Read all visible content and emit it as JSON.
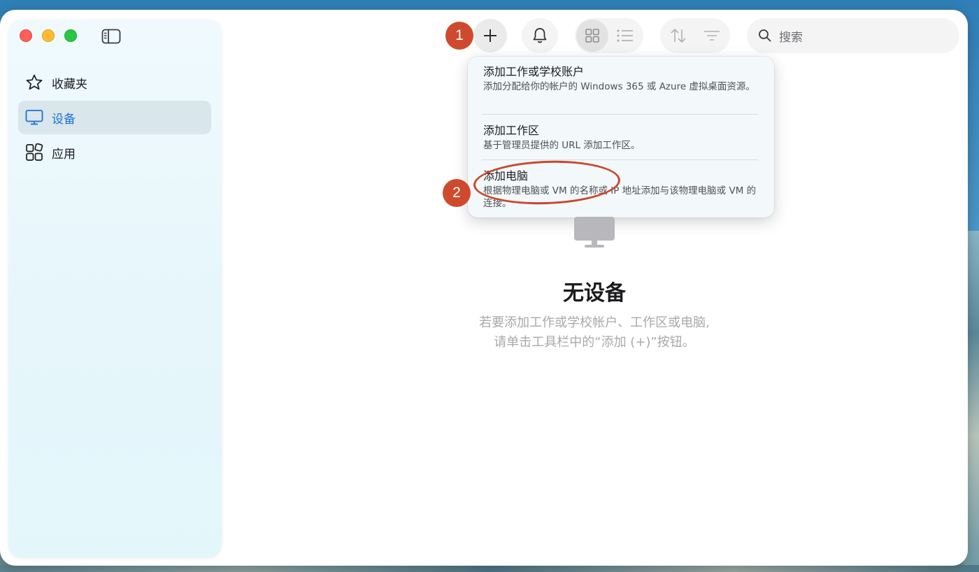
{
  "sidebar": {
    "items": [
      {
        "label": "收藏夹",
        "icon": "star-icon",
        "active": false
      },
      {
        "label": "设备",
        "icon": "monitor-icon",
        "active": true
      },
      {
        "label": "应用",
        "icon": "apps-icon",
        "active": false
      }
    ]
  },
  "toolbar": {
    "search_placeholder": "搜索"
  },
  "annotations": {
    "badge1": "1",
    "badge2": "2"
  },
  "add_menu": {
    "items": [
      {
        "title": "添加工作或学校账户",
        "desc": "添加分配给你的帐户的 Windows 365 或 Azure 虚拟桌面资源。"
      },
      {
        "title": "添加工作区",
        "desc": "基于管理员提供的 URL 添加工作区。"
      },
      {
        "title": "添加电脑",
        "desc": "根据物理电脑或 VM 的名称或 IP 地址添加与该物理电脑或 VM 的连接。"
      }
    ]
  },
  "empty_state": {
    "title": "无设备",
    "line1": "若要添加工作或学校帐户、工作区或电脑,",
    "line2": "请单击工具栏中的“添加 (+)”按钮。"
  },
  "colors": {
    "accent": "#1a6fd6",
    "annotation": "#cf4a2d"
  }
}
